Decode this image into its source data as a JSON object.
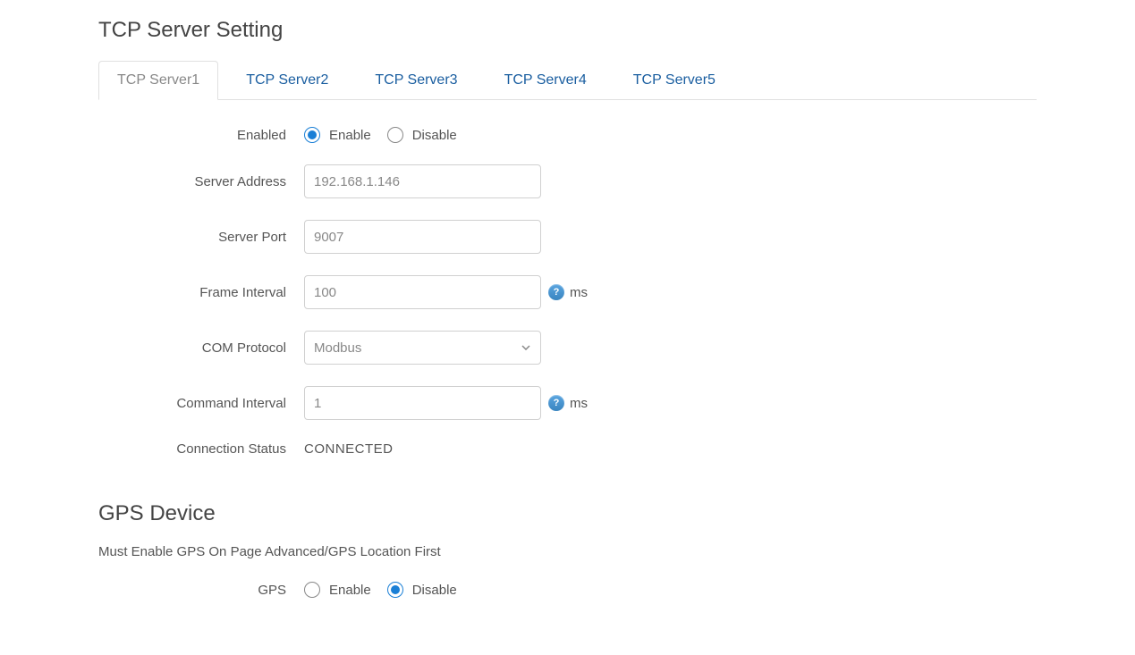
{
  "tcp": {
    "title": "TCP Server Setting",
    "tabs": [
      {
        "label": "TCP Server1",
        "active": true
      },
      {
        "label": "TCP Server2",
        "active": false
      },
      {
        "label": "TCP Server3",
        "active": false
      },
      {
        "label": "TCP Server4",
        "active": false
      },
      {
        "label": "TCP Server5",
        "active": false
      }
    ],
    "fields": {
      "enabled": {
        "label": "Enabled",
        "options": {
          "enable": "Enable",
          "disable": "Disable"
        },
        "value": "enable"
      },
      "server_address": {
        "label": "Server Address",
        "value": "192.168.1.146"
      },
      "server_port": {
        "label": "Server Port",
        "value": "9007"
      },
      "frame_interval": {
        "label": "Frame Interval",
        "value": "100",
        "unit": "ms"
      },
      "com_protocol": {
        "label": "COM Protocol",
        "value": "Modbus"
      },
      "command_interval": {
        "label": "Command Interval",
        "value": "1",
        "unit": "ms"
      },
      "connection_status": {
        "label": "Connection Status",
        "value": "CONNECTED"
      }
    }
  },
  "gps": {
    "title": "GPS Device",
    "note": "Must Enable GPS On Page Advanced/GPS Location First",
    "fields": {
      "gps": {
        "label": "GPS",
        "options": {
          "enable": "Enable",
          "disable": "Disable"
        },
        "value": "disable"
      }
    }
  },
  "help_glyph": "?"
}
